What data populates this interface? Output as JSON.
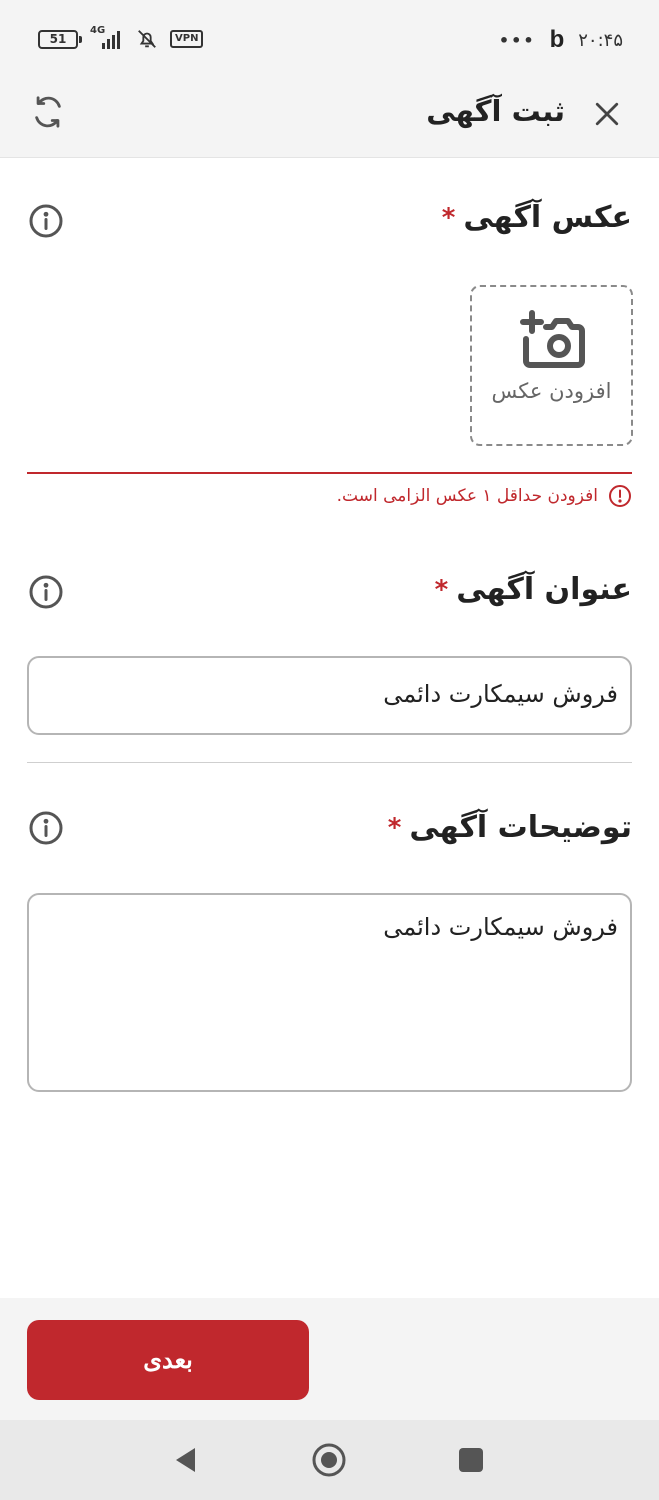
{
  "status_bar": {
    "battery": "51",
    "network": "4G",
    "vpn": "VPN",
    "dots": "•••",
    "app_letter": "b",
    "time": "۲۰:۴۵"
  },
  "header": {
    "title": "ثبت آگهی",
    "close_icon": "close-icon",
    "refresh_icon": "refresh-icon"
  },
  "photo_section": {
    "title": "عکس آگهی",
    "required": "*",
    "add_photo_label": "افزودن عکس",
    "error": "افزودن حداقل ۱ عکس الزامی است."
  },
  "title_section": {
    "title": "عنوان آگهی",
    "required": "*",
    "value": "فروش سیمکارت دائمی"
  },
  "description_section": {
    "title": "توضیحات آگهی",
    "required": "*",
    "value": "فروش سیمکارت دائمی"
  },
  "footer": {
    "next_label": "بعدی"
  },
  "colors": {
    "accent": "#c0282d",
    "background": "#ffffff",
    "bar": "#f4f4f4"
  }
}
